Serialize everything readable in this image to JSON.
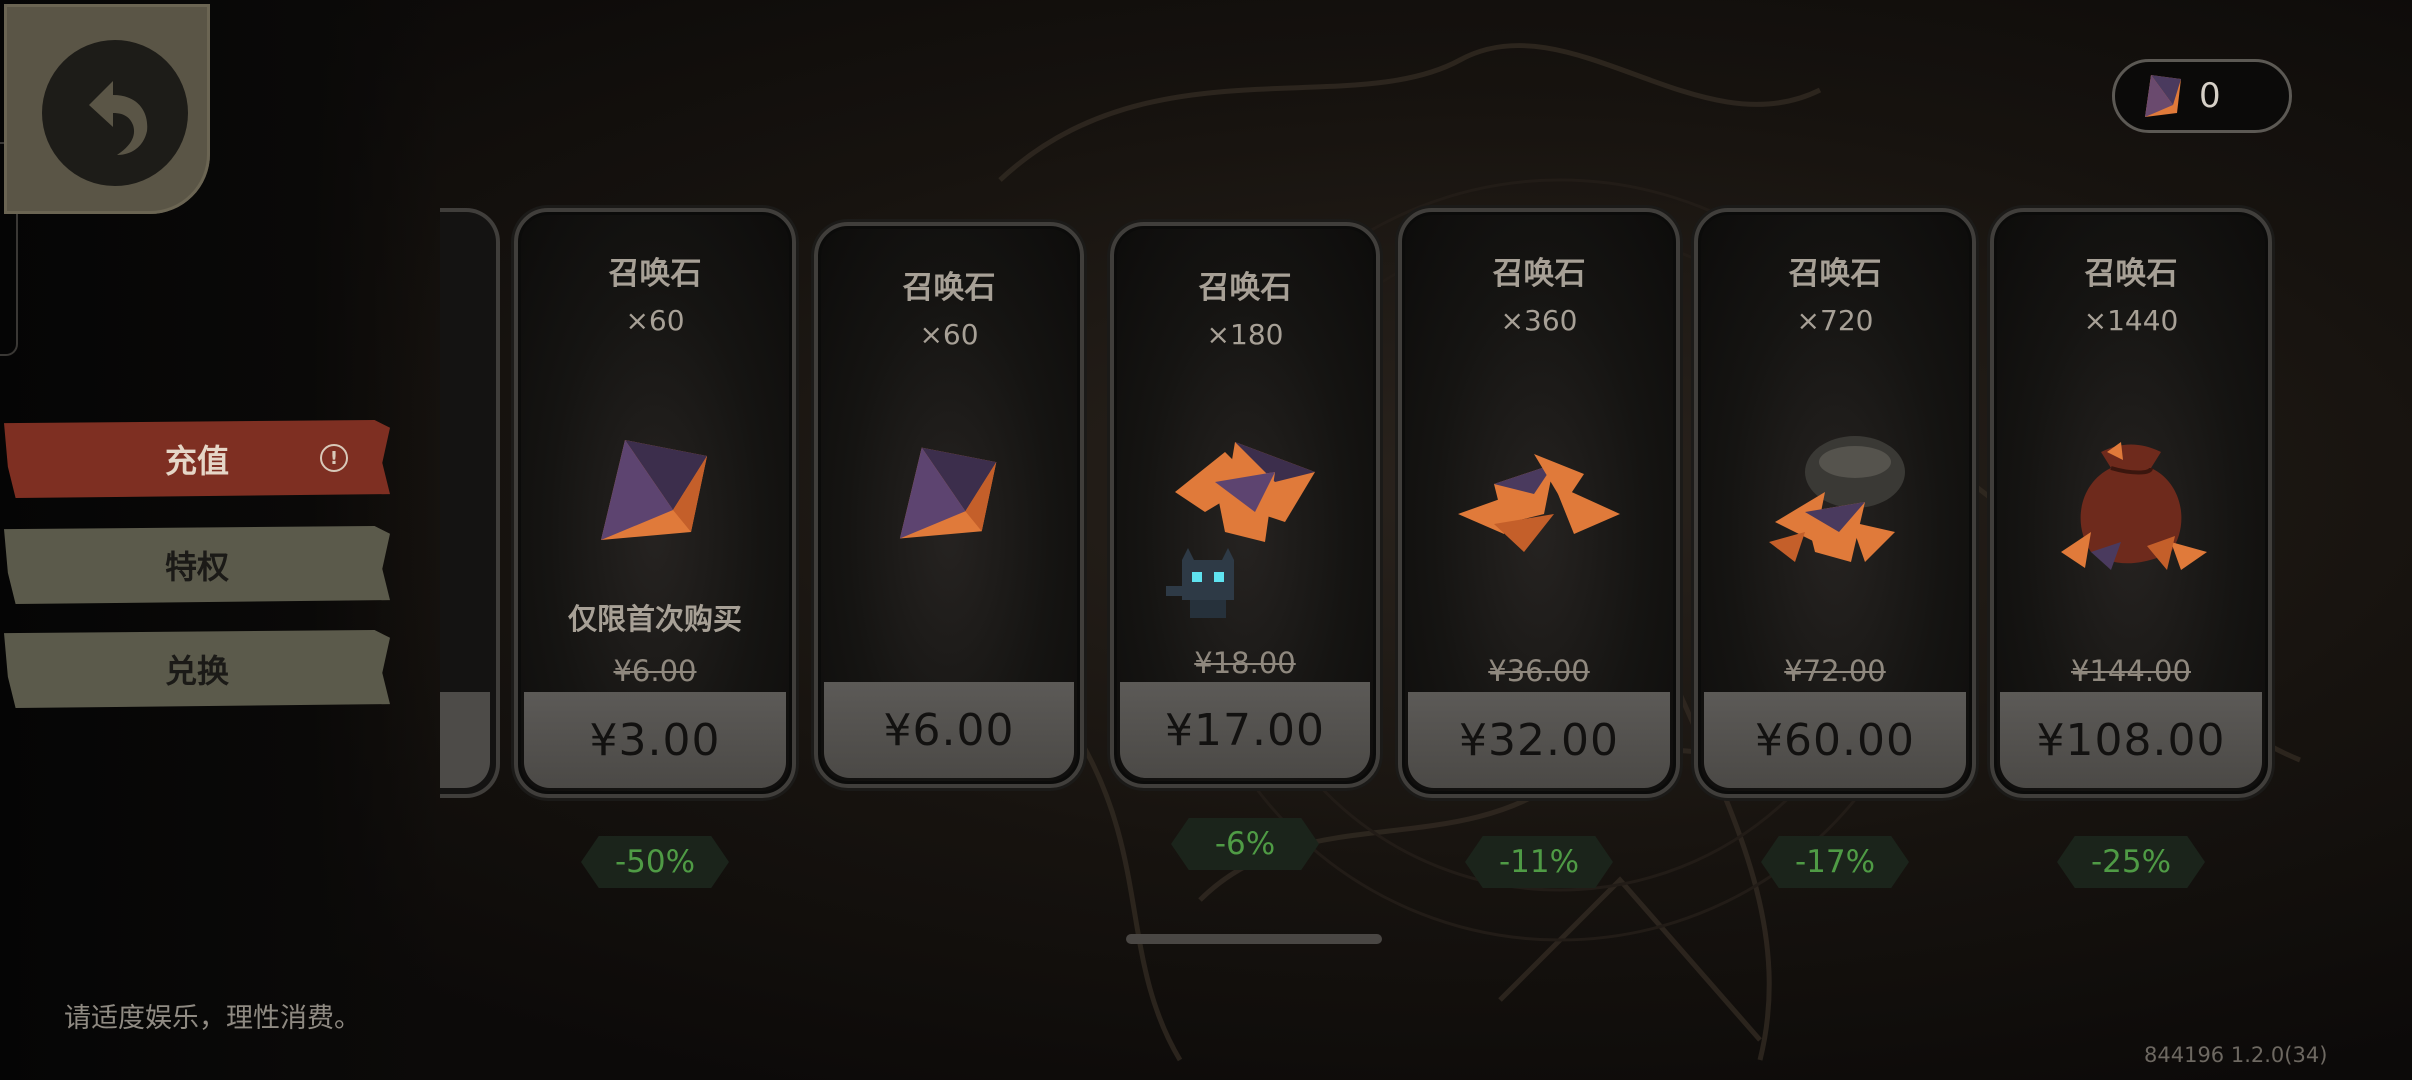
{
  "balance": {
    "icon": "summon-stone-icon",
    "value": "0"
  },
  "sidebar": {
    "back": "back-arrow-icon",
    "tabs": [
      {
        "label": "充值",
        "active": true,
        "alert": "!"
      },
      {
        "label": "特权",
        "active": false
      },
      {
        "label": "兑换",
        "active": false
      }
    ]
  },
  "notice": "请适度娱乐，理性消费。",
  "version": "844196 1.2.0(34)",
  "products": [
    {
      "name": "召唤石",
      "qty": "×60",
      "limit": "仅限首次购买",
      "original": "¥6.00",
      "price": "¥3.00",
      "discount": "-50%"
    },
    {
      "name": "召唤石",
      "qty": "×60",
      "price": "¥6.00"
    },
    {
      "name": "召唤石",
      "qty": "×180",
      "original": "¥18.00",
      "price": "¥17.00",
      "discount": "-6%"
    },
    {
      "name": "召唤石",
      "qty": "×360",
      "original": "¥36.00",
      "price": "¥32.00",
      "discount": "-11%"
    },
    {
      "name": "召唤石",
      "qty": "×720",
      "original": "¥72.00",
      "price": "¥60.00",
      "discount": "-17%"
    },
    {
      "name": "召唤石",
      "qty": "×1440",
      "original": "¥144.00",
      "price": "¥108.00",
      "discount": "-25%"
    }
  ],
  "colors": {
    "active_tab": "#7e2f22",
    "inactive_tab": "#5b5a4b",
    "discount_text": "#4f9b45",
    "gem_orange": "#e07a3a",
    "gem_purple": "#4a3a5e"
  }
}
